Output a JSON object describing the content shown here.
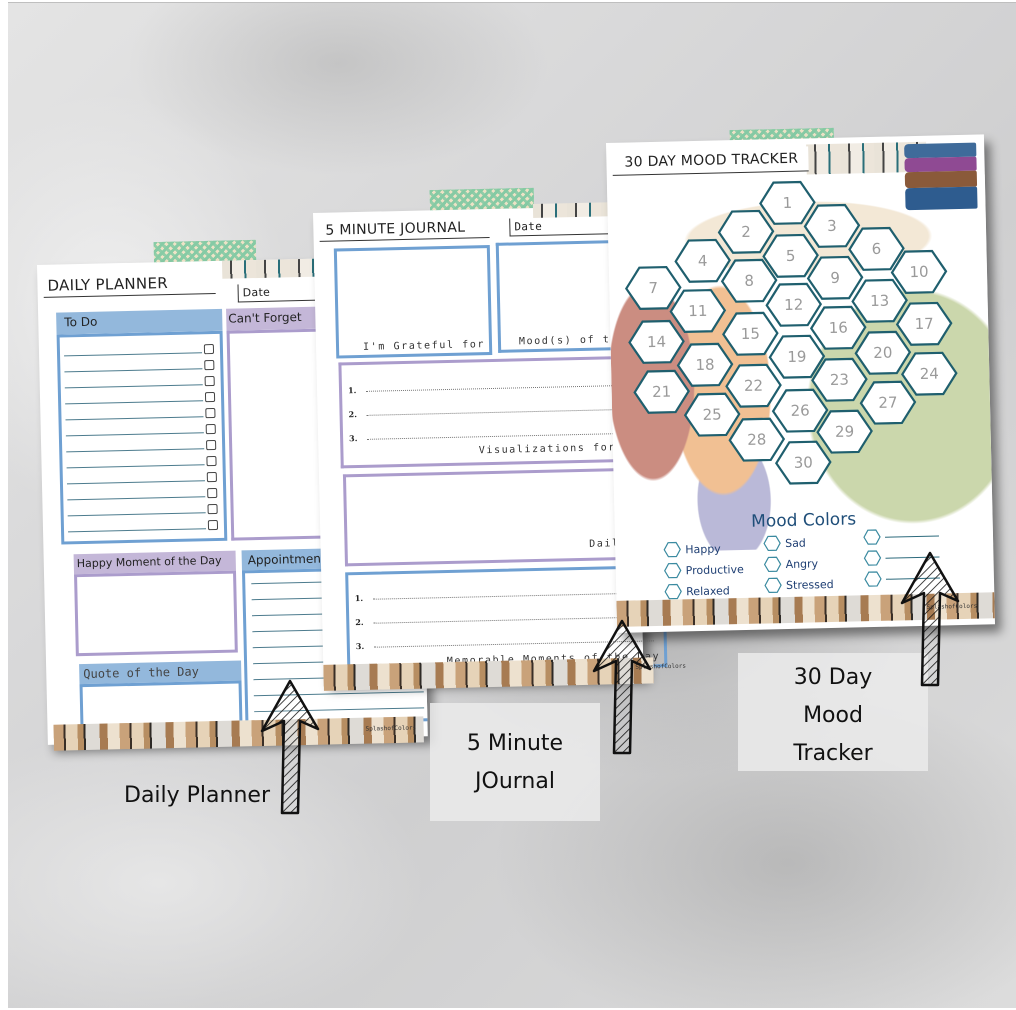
{
  "daily_planner": {
    "title": "DAILY PLANNER",
    "date_label": "Date",
    "sections": {
      "todo": "To Do",
      "cant_forget": "Can't Forget",
      "happy_moment": "Happy Moment of the Day",
      "appointments": "Appointments",
      "quote": "Quote of the Day"
    },
    "todo_rows": 12,
    "watermark": "SplashofColors",
    "caption": "Daily Planner"
  },
  "five_minute_journal": {
    "title": "5 MINUTE JOURNAL",
    "date_label": "Date",
    "sections": {
      "grateful": "I'm Grateful for",
      "moods": "Mood(s) of the",
      "visualizations": "Visualizations for the",
      "daily": "Daily C",
      "memorable": "Memorable Moments of the Day"
    },
    "list_numbers": [
      "1.",
      "2.",
      "3."
    ],
    "watermark": "SplashofColors",
    "caption_line1": "5 Minute",
    "caption_line2": "JOurnal"
  },
  "mood_tracker": {
    "title": "30 DAY MOOD TRACKER",
    "days": [
      "1",
      "2",
      "3",
      "4",
      "5",
      "6",
      "7",
      "8",
      "9",
      "10",
      "11",
      "12",
      "13",
      "14",
      "15",
      "16",
      "17",
      "18",
      "19",
      "20",
      "21",
      "22",
      "23",
      "24",
      "25",
      "26",
      "27",
      "28",
      "29",
      "30"
    ],
    "mood_colors_title": "Mood Colors",
    "moods": [
      {
        "label": "Happy"
      },
      {
        "label": "Productive"
      },
      {
        "label": "Relaxed"
      },
      {
        "label": "Sad"
      },
      {
        "label": "Angry"
      },
      {
        "label": "Stressed"
      },
      {
        "label": ""
      },
      {
        "label": ""
      },
      {
        "label": ""
      }
    ],
    "watermark": "SplashofColors",
    "caption_line1": "30 Day",
    "caption_line2": "Mood",
    "caption_line3": "Tracker"
  },
  "colors": {
    "blue_header": "#93b8dc",
    "blue_frame": "#6fa0d2",
    "purple_header": "#c4b7d8",
    "purple_frame": "#ab9ccc",
    "hex_stroke": "#1f5f6e",
    "mood_text": "#1f4e79",
    "washi_green": "#7fc9a0"
  }
}
